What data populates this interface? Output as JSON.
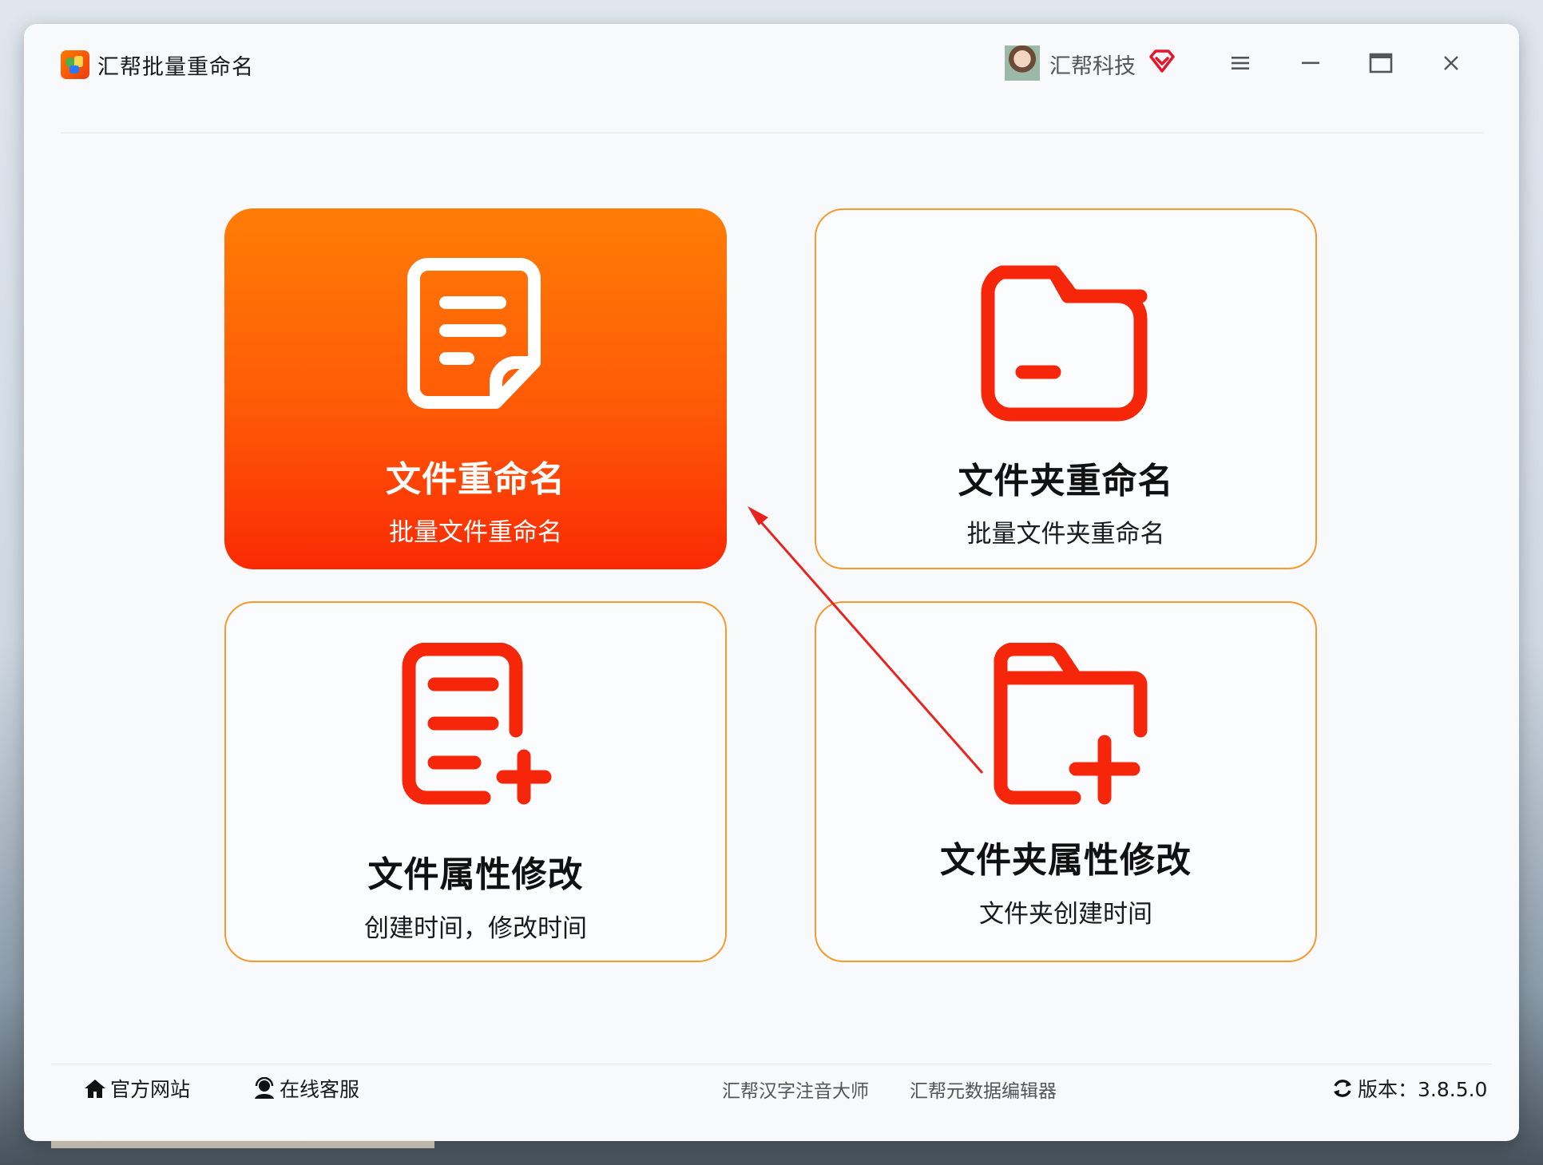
{
  "app": {
    "title": "汇帮批量重命名"
  },
  "user": {
    "name": "汇帮科技"
  },
  "colors": {
    "accent": "#ff6a00",
    "icon_red": "#f5260a",
    "card_border": "#f59a30",
    "active_grad_top": "#ff7d06",
    "active_grad_bottom": "#fa2a04"
  },
  "window_controls": [
    "menu-icon",
    "minimize-icon",
    "maximize-icon",
    "close-icon"
  ],
  "cards": [
    {
      "title": "文件重命名",
      "subtitle": "批量文件重命名",
      "icon": "document-icon",
      "active": true
    },
    {
      "title": "文件夹重命名",
      "subtitle": "批量文件夹重命名",
      "icon": "folder-icon",
      "active": false
    },
    {
      "title": "文件属性修改",
      "subtitle": "创建时间，修改时间",
      "icon": "document-add-icon",
      "active": false
    },
    {
      "title": "文件夹属性修改",
      "subtitle": "文件夹创建时间",
      "icon": "folder-add-icon",
      "active": false
    }
  ],
  "footer": {
    "website": "官方网站",
    "support": "在线客服",
    "link1": "汇帮汉字注音大师",
    "link2": "汇帮元数据编辑器",
    "version": "版本：3.8.5.0"
  }
}
